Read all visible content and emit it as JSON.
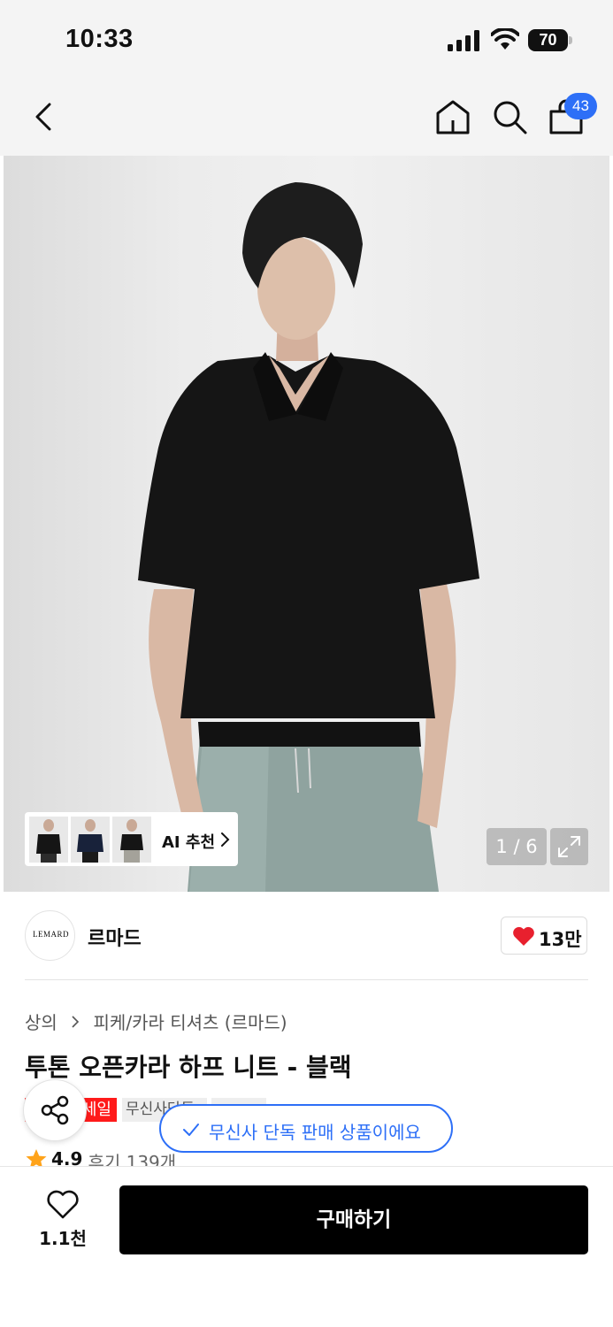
{
  "status_bar": {
    "time": "10:33",
    "battery": "70"
  },
  "header": {
    "cart_count": "43"
  },
  "gallery": {
    "ai_recommend_label": "AI 추천",
    "page_indicator": "1 / 6",
    "page_current": 1,
    "page_total": 6
  },
  "brand": {
    "name": "르마드",
    "logo_text": "LEMARD",
    "like_count": "13만"
  },
  "breadcrumb": {
    "category": "상의",
    "subcategory": "피케/카라 티셔츠 (르마드)"
  },
  "product": {
    "title": "투톤 오픈카라 하프 니트 - 블랙",
    "tag_sale": "세일",
    "tag_exclusive": "무신사단독",
    "rating": "4.9",
    "reviews": "후기 139개"
  },
  "toast": {
    "text": "무신사 단독 판매 상품이에요"
  },
  "bottom_bar": {
    "wish_count": "1.1천",
    "buy_label": "구매하기"
  },
  "colors": {
    "accent_blue": "#2d6ff7",
    "sale_red": "#ff1a1a",
    "heart_red": "#e8202e",
    "star": "#ffa31a"
  }
}
